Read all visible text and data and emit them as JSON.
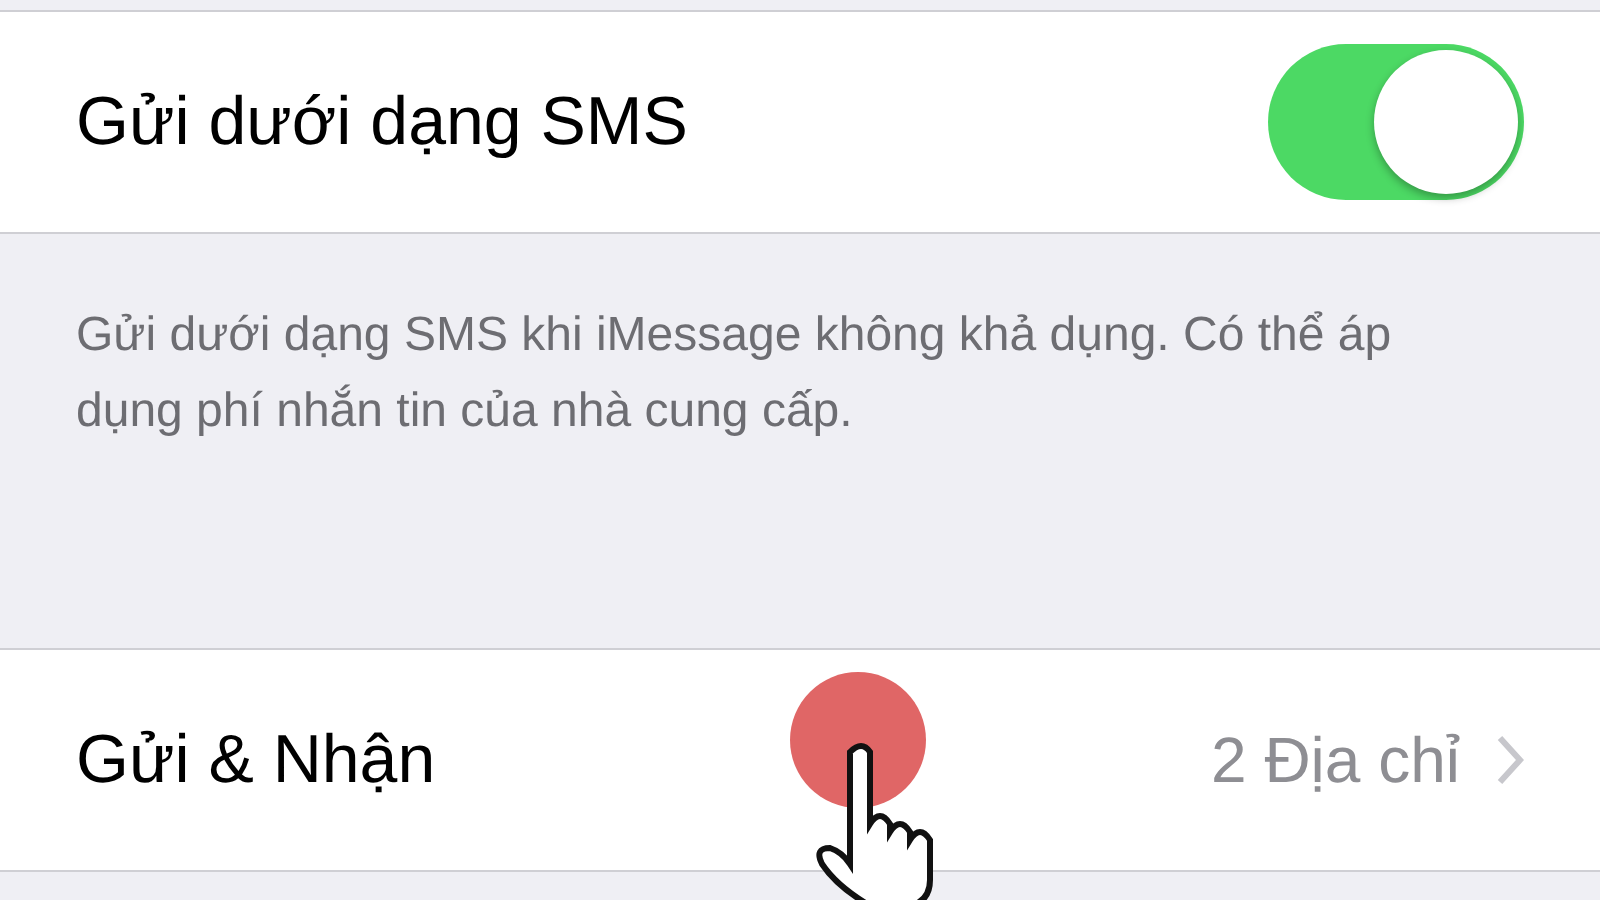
{
  "sms_row": {
    "label": "Gửi dưới dạng SMS",
    "on": true
  },
  "sms_footer": "Gửi dưới dạng SMS khi iMessage không khả dụng. Có thể áp dụng phí nhắn tin của nhà cung cấp.",
  "send_receive_row": {
    "label": "Gửi & Nhận",
    "value": "2 Địa chỉ"
  }
}
